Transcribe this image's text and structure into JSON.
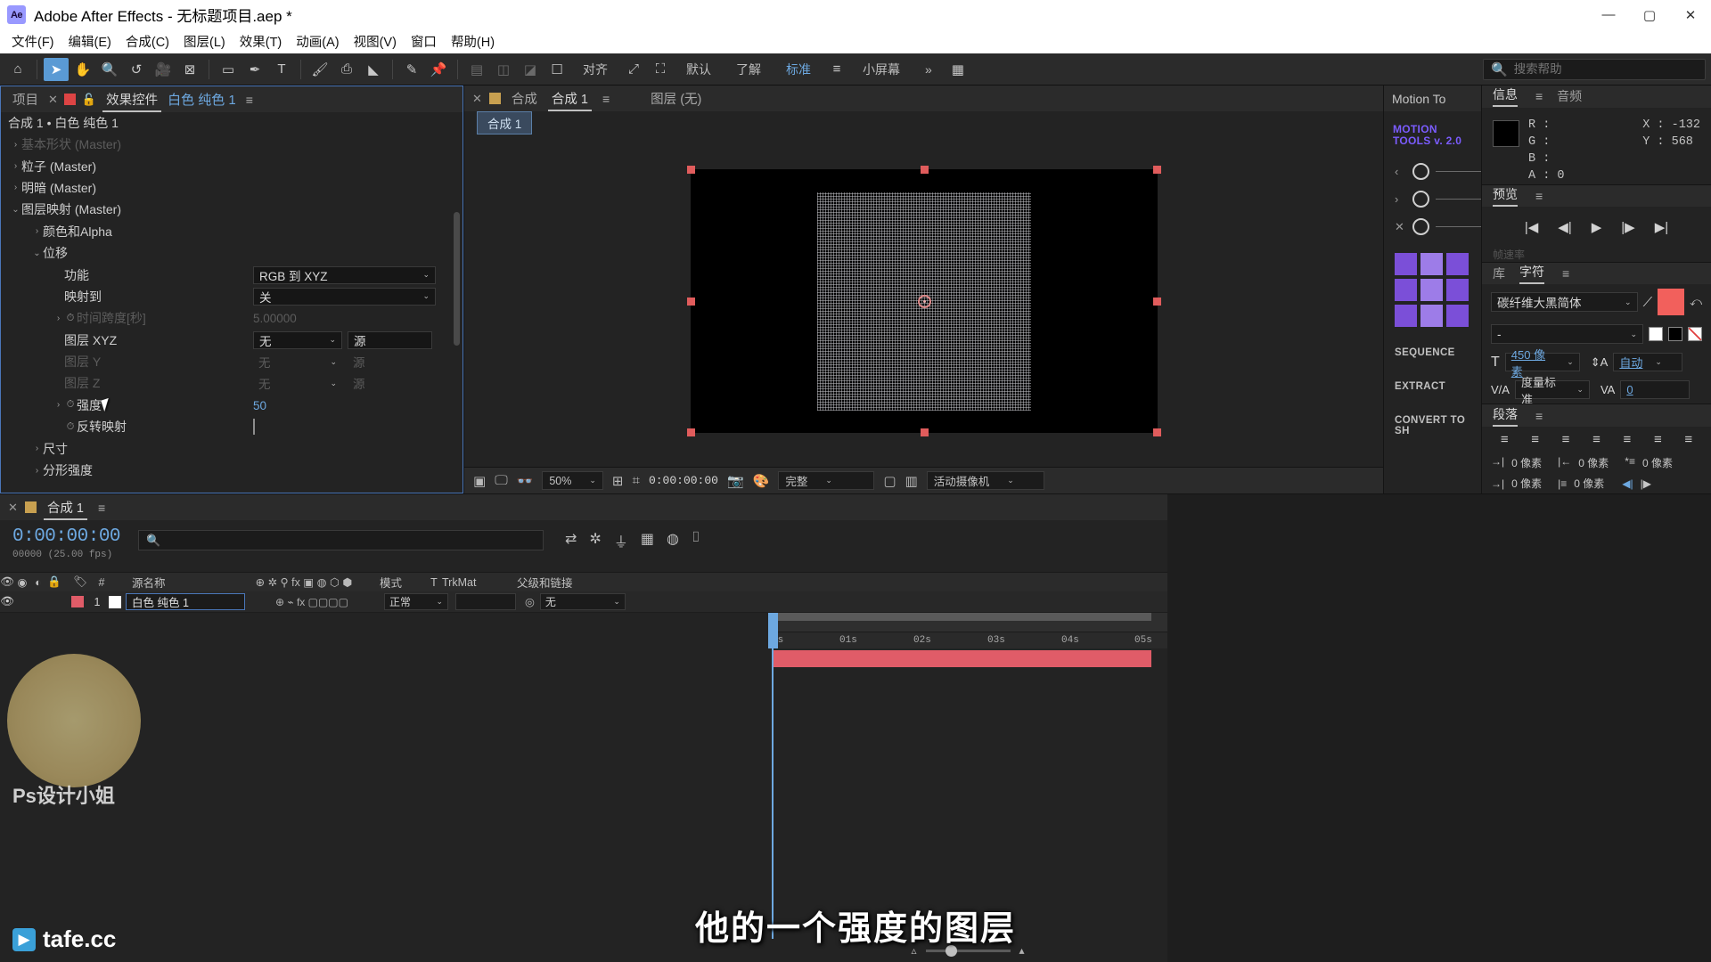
{
  "window": {
    "app_badge": "Ae",
    "title": "Adobe After Effects - 无标题项目.aep *",
    "minimize": "—",
    "maximize": "▢",
    "close": "✕"
  },
  "menubar": {
    "items": [
      "文件(F)",
      "编辑(E)",
      "合成(C)",
      "图层(L)",
      "效果(T)",
      "动画(A)",
      "视图(V)",
      "窗口",
      "帮助(H)"
    ]
  },
  "toolbar": {
    "icons": [
      "home-icon",
      "selection-tool-icon",
      "hand-tool-icon",
      "zoom-tool-icon",
      "rotation-tool-icon",
      "camera-tool-icon",
      "anchor-point-tool-icon",
      "shape-tool-icon",
      "pen-tool-icon",
      "type-tool-icon",
      "brush-tool-icon",
      "clone-stamp-tool-icon",
      "eraser-tool-icon",
      "roto-brush-tool-icon",
      "puppet-pin-tool-icon"
    ],
    "align_label": "对齐",
    "snapping_icons": [
      "snap-icon",
      "grid-snap-icon"
    ],
    "workspaces": [
      "默认",
      "了解",
      "标准",
      "小屏幕"
    ],
    "workspace_active": "标准",
    "overflow": "»",
    "layout_icon": "workspace-layout-icon",
    "search_placeholder": "搜索帮助",
    "accent_blue": "#6da8e0"
  },
  "effect_controls": {
    "tabs": [
      {
        "label": "项目",
        "active": false
      },
      {
        "label": "效果控件",
        "active": true,
        "suffix": "白色 纯色 1"
      }
    ],
    "close_x": "✕",
    "menu_icon": "≡",
    "lock_icon": "🔒",
    "breadcrumb": "合成 1 • 白色 纯色 1",
    "rows": [
      {
        "indent": 1,
        "arrow": "›",
        "name": "基本形状 (Master)",
        "dim": true,
        "type": "group"
      },
      {
        "indent": 1,
        "arrow": "›",
        "name": "粒子 (Master)",
        "dim": false,
        "type": "group"
      },
      {
        "indent": 1,
        "arrow": "›",
        "name": "明暗 (Master)",
        "dim": false,
        "type": "group"
      },
      {
        "indent": 1,
        "arrow": "⌄",
        "name": "图层映射 (Master)",
        "dim": false,
        "type": "group"
      },
      {
        "indent": 2,
        "arrow": "›",
        "name": "颜色和Alpha",
        "dim": false,
        "type": "group"
      },
      {
        "indent": 2,
        "arrow": "⌄",
        "name": "位移",
        "dim": false,
        "type": "group"
      },
      {
        "indent": 3,
        "arrow": "",
        "name": "功能",
        "dim": false,
        "type": "dropdown",
        "value": "RGB 到 XYZ"
      },
      {
        "indent": 3,
        "arrow": "",
        "name": "映射到",
        "dim": false,
        "type": "dropdown",
        "value": "关"
      },
      {
        "indent": 3,
        "arrow": "›",
        "name": "时间跨度[秒]",
        "dim": true,
        "type": "number",
        "value": "5.00000",
        "stopwatch": true
      },
      {
        "indent": 3,
        "arrow": "",
        "name": "图层 XYZ",
        "dim": false,
        "type": "layer-pick",
        "value": "无",
        "value2": "源"
      },
      {
        "indent": 3,
        "arrow": "",
        "name": "图层 Y",
        "dim": true,
        "type": "layer-pick",
        "value": "无",
        "value2": "源"
      },
      {
        "indent": 3,
        "arrow": "",
        "name": "图层 Z",
        "dim": true,
        "type": "layer-pick",
        "value": "无",
        "value2": "源"
      },
      {
        "indent": 3,
        "arrow": "›",
        "name": "强度",
        "dim": false,
        "type": "number",
        "value": "50",
        "stopwatch": true
      },
      {
        "indent": 3,
        "arrow": "",
        "name": "反转映射",
        "dim": false,
        "type": "checkbox",
        "value": "",
        "stopwatch": true
      },
      {
        "indent": 2,
        "arrow": "›",
        "name": "尺寸",
        "dim": false,
        "type": "group"
      },
      {
        "indent": 2,
        "arrow": "›",
        "name": "分形强度",
        "dim": false,
        "type": "group"
      }
    ]
  },
  "composition": {
    "close_x": "✕",
    "tab_prefix": "合成",
    "tab_name": "合成 1",
    "menu_icon": "≡",
    "layer_tab": "图层 (无)",
    "chip": "合成 1",
    "viewer_bar": {
      "zoom": "50%",
      "timecode": "0:00:00:00",
      "quality": "完整",
      "camera": "活动摄像机",
      "icons": [
        "render-region-icon",
        "toggle-transparency-icon",
        "3d-view-icon",
        "grid-guides-icon",
        "mask-icon",
        "snapshot-icon",
        "channel-icon",
        "region-of-interest-icon",
        "transparency-grid-icon"
      ]
    }
  },
  "motion_tools": {
    "panel_title": "Motion To",
    "logo_line1": "MOTION",
    "logo_line2": "TOOLS v. 2.0",
    "rows": [
      "‹",
      "›",
      "✕"
    ],
    "buttons": [
      "SEQUENCE",
      "EXTRACT",
      "CONVERT TO SH"
    ],
    "brand_color": "#7b5cff"
  },
  "info_panel": {
    "tabs": [
      {
        "label": "信息",
        "active": true
      },
      {
        "label": "音频",
        "active": false
      }
    ],
    "menu_icon": "≡",
    "channels": [
      "R :",
      "G :",
      "B :",
      "A : 0"
    ],
    "coords": [
      "X : -132",
      "Y : 568"
    ],
    "plus": "+"
  },
  "preview_panel": {
    "title": "预览",
    "menu_icon": "≡",
    "controls": [
      "|◀",
      "◀|",
      "▶",
      "|▶",
      "▶|"
    ],
    "ghost_label": "帧速率"
  },
  "character_panel": {
    "tabs": [
      {
        "label": "库",
        "active": false
      },
      {
        "label": "字符",
        "active": true
      }
    ],
    "menu_icon": "≡",
    "font_family": "碳纤维大黑简体",
    "font_style": "-",
    "font_size": "450 像素",
    "leading": "自动",
    "tracking": "0",
    "kerning": "度量标准",
    "size_icon": "font-size-icon",
    "leading_icon": "leading-icon",
    "tracking_icon": "tracking-icon",
    "fill_color": "#f2605c"
  },
  "paragraph_panel": {
    "title": "段落",
    "menu_icon": "≡",
    "align_icons": [
      "align-left-icon",
      "align-center-icon",
      "align-right-icon",
      "justify-last-left-icon",
      "justify-last-center-icon",
      "justify-last-right-icon",
      "justify-all-icon"
    ],
    "fields": [
      {
        "icon": "indent-left-icon",
        "value": "0 像素"
      },
      {
        "icon": "indent-right-icon",
        "value": "0 像素"
      },
      {
        "icon": "indent-first-icon",
        "value": "0 像素"
      },
      {
        "icon": "space-before-icon",
        "value": "0 像素"
      },
      {
        "icon": "space-after-icon",
        "value": "0 像素"
      }
    ]
  },
  "timeline": {
    "tab_label": "合成 1",
    "close_x": "✕",
    "menu_icon": "≡",
    "current_time": "0:00:00:00",
    "time_sub": "00000 (25.00 fps)",
    "search_placeholder": "",
    "search_icon": "search-icon",
    "switch_icons": [
      "composition-mini-flowchart-icon",
      "draft-3d-icon",
      "hide-shy-icon",
      "frame-blending-icon",
      "motion-blur-icon",
      "graph-editor-icon"
    ],
    "columns": [
      "#",
      "源名称",
      "模式",
      "T",
      "TrkMat",
      "父级和链接"
    ],
    "column_icons": [
      "video-icon",
      "audio-icon",
      "solo-icon",
      "lock-icon",
      "label-icon"
    ],
    "layer_switch_icons": [
      "shy-icon",
      "collapse-icon",
      "quality-icon",
      "effects-icon",
      "frame-blend-icon",
      "motion-blur-icon",
      "adjustment-icon",
      "3d-layer-icon"
    ],
    "rows": [
      {
        "index": "1",
        "name": "白色 纯色 1",
        "mode": "正常",
        "trkmat": "",
        "parent": "无",
        "color": "#e05c68",
        "swatch": "#ffffff"
      }
    ],
    "ruler_ticks": [
      "0s",
      "01s",
      "02s",
      "03s",
      "04s",
      "05s"
    ],
    "zoom_value": ""
  },
  "watermark": {
    "brand_text": "tafe.cc",
    "sticker_text": "Ps设计小姐"
  },
  "subtitle": {
    "text": "他的一个强度的图层"
  }
}
